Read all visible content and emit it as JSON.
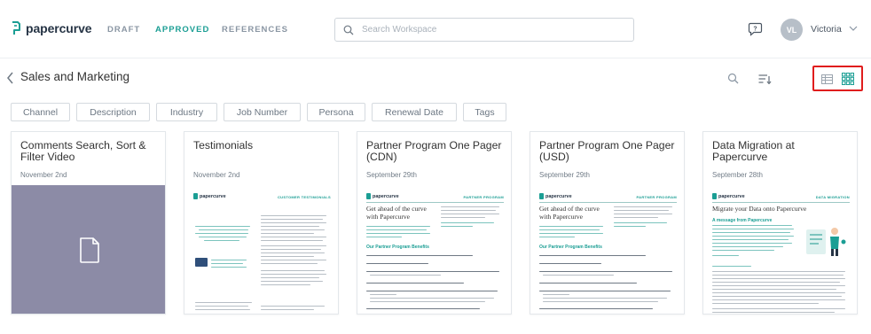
{
  "brand": {
    "name": "papercurve"
  },
  "nav": {
    "tabs": [
      {
        "label": "DRAFT"
      },
      {
        "label": "APPROVED"
      },
      {
        "label": "REFERENCES"
      }
    ]
  },
  "search": {
    "placeholder": "Search Workspace"
  },
  "user": {
    "initials": "VL",
    "name": "Victoria"
  },
  "page": {
    "title": "Sales and Marketing"
  },
  "filters": [
    "Channel",
    "Description",
    "Industry",
    "Job Number",
    "Persona",
    "Renewal Date",
    "Tags"
  ],
  "cards": [
    {
      "title": "Comments Search, Sort & Filter Video",
      "date": "November 2nd",
      "preview": "file-icon"
    },
    {
      "title": "Testimonials",
      "date": "November 2nd",
      "preview": "document",
      "doc_tag": "CUSTOMER TESTIMONIALS"
    },
    {
      "title": "Partner Program One Pager (CDN)",
      "date": "September 29th",
      "preview": "document",
      "doc_tag": "PARTNER PROGRAM",
      "doc_heading": "Get ahead of the curve with Papercurve",
      "doc_subheading": "Our Partner Program Benefits"
    },
    {
      "title": "Partner Program One Pager (USD)",
      "date": "September 29th",
      "preview": "document",
      "doc_tag": "PARTNER PROGRAM",
      "doc_heading": "Get ahead of the curve with Papercurve",
      "doc_subheading": "Our Partner Program Benefits"
    },
    {
      "title": "Data Migration at Papercurve",
      "date": "September 28th",
      "preview": "document",
      "doc_tag": "DATA MIGRATION",
      "doc_heading": "Migrate your Data onto Papercurve",
      "doc_subheading": "A message from Papercurve"
    }
  ],
  "colors": {
    "accent": "#1b9e94",
    "highlight": "#e01d1d",
    "video_preview": "#8c8ba6"
  }
}
